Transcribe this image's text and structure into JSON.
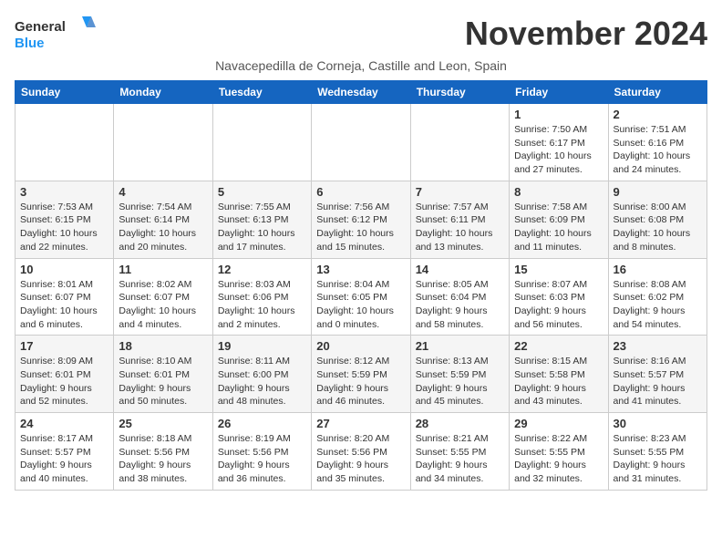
{
  "header": {
    "logo_line1": "General",
    "logo_line2": "Blue",
    "month_title": "November 2024",
    "subtitle": "Navacepedilla de Corneja, Castille and Leon, Spain"
  },
  "weekdays": [
    "Sunday",
    "Monday",
    "Tuesday",
    "Wednesday",
    "Thursday",
    "Friday",
    "Saturday"
  ],
  "weeks": [
    [
      {
        "day": "",
        "info": ""
      },
      {
        "day": "",
        "info": ""
      },
      {
        "day": "",
        "info": ""
      },
      {
        "day": "",
        "info": ""
      },
      {
        "day": "",
        "info": ""
      },
      {
        "day": "1",
        "info": "Sunrise: 7:50 AM\nSunset: 6:17 PM\nDaylight: 10 hours and 27 minutes."
      },
      {
        "day": "2",
        "info": "Sunrise: 7:51 AM\nSunset: 6:16 PM\nDaylight: 10 hours and 24 minutes."
      }
    ],
    [
      {
        "day": "3",
        "info": "Sunrise: 7:53 AM\nSunset: 6:15 PM\nDaylight: 10 hours and 22 minutes."
      },
      {
        "day": "4",
        "info": "Sunrise: 7:54 AM\nSunset: 6:14 PM\nDaylight: 10 hours and 20 minutes."
      },
      {
        "day": "5",
        "info": "Sunrise: 7:55 AM\nSunset: 6:13 PM\nDaylight: 10 hours and 17 minutes."
      },
      {
        "day": "6",
        "info": "Sunrise: 7:56 AM\nSunset: 6:12 PM\nDaylight: 10 hours and 15 minutes."
      },
      {
        "day": "7",
        "info": "Sunrise: 7:57 AM\nSunset: 6:11 PM\nDaylight: 10 hours and 13 minutes."
      },
      {
        "day": "8",
        "info": "Sunrise: 7:58 AM\nSunset: 6:09 PM\nDaylight: 10 hours and 11 minutes."
      },
      {
        "day": "9",
        "info": "Sunrise: 8:00 AM\nSunset: 6:08 PM\nDaylight: 10 hours and 8 minutes."
      }
    ],
    [
      {
        "day": "10",
        "info": "Sunrise: 8:01 AM\nSunset: 6:07 PM\nDaylight: 10 hours and 6 minutes."
      },
      {
        "day": "11",
        "info": "Sunrise: 8:02 AM\nSunset: 6:07 PM\nDaylight: 10 hours and 4 minutes."
      },
      {
        "day": "12",
        "info": "Sunrise: 8:03 AM\nSunset: 6:06 PM\nDaylight: 10 hours and 2 minutes."
      },
      {
        "day": "13",
        "info": "Sunrise: 8:04 AM\nSunset: 6:05 PM\nDaylight: 10 hours and 0 minutes."
      },
      {
        "day": "14",
        "info": "Sunrise: 8:05 AM\nSunset: 6:04 PM\nDaylight: 9 hours and 58 minutes."
      },
      {
        "day": "15",
        "info": "Sunrise: 8:07 AM\nSunset: 6:03 PM\nDaylight: 9 hours and 56 minutes."
      },
      {
        "day": "16",
        "info": "Sunrise: 8:08 AM\nSunset: 6:02 PM\nDaylight: 9 hours and 54 minutes."
      }
    ],
    [
      {
        "day": "17",
        "info": "Sunrise: 8:09 AM\nSunset: 6:01 PM\nDaylight: 9 hours and 52 minutes."
      },
      {
        "day": "18",
        "info": "Sunrise: 8:10 AM\nSunset: 6:01 PM\nDaylight: 9 hours and 50 minutes."
      },
      {
        "day": "19",
        "info": "Sunrise: 8:11 AM\nSunset: 6:00 PM\nDaylight: 9 hours and 48 minutes."
      },
      {
        "day": "20",
        "info": "Sunrise: 8:12 AM\nSunset: 5:59 PM\nDaylight: 9 hours and 46 minutes."
      },
      {
        "day": "21",
        "info": "Sunrise: 8:13 AM\nSunset: 5:59 PM\nDaylight: 9 hours and 45 minutes."
      },
      {
        "day": "22",
        "info": "Sunrise: 8:15 AM\nSunset: 5:58 PM\nDaylight: 9 hours and 43 minutes."
      },
      {
        "day": "23",
        "info": "Sunrise: 8:16 AM\nSunset: 5:57 PM\nDaylight: 9 hours and 41 minutes."
      }
    ],
    [
      {
        "day": "24",
        "info": "Sunrise: 8:17 AM\nSunset: 5:57 PM\nDaylight: 9 hours and 40 minutes."
      },
      {
        "day": "25",
        "info": "Sunrise: 8:18 AM\nSunset: 5:56 PM\nDaylight: 9 hours and 38 minutes."
      },
      {
        "day": "26",
        "info": "Sunrise: 8:19 AM\nSunset: 5:56 PM\nDaylight: 9 hours and 36 minutes."
      },
      {
        "day": "27",
        "info": "Sunrise: 8:20 AM\nSunset: 5:56 PM\nDaylight: 9 hours and 35 minutes."
      },
      {
        "day": "28",
        "info": "Sunrise: 8:21 AM\nSunset: 5:55 PM\nDaylight: 9 hours and 34 minutes."
      },
      {
        "day": "29",
        "info": "Sunrise: 8:22 AM\nSunset: 5:55 PM\nDaylight: 9 hours and 32 minutes."
      },
      {
        "day": "30",
        "info": "Sunrise: 8:23 AM\nSunset: 5:55 PM\nDaylight: 9 hours and 31 minutes."
      }
    ]
  ]
}
